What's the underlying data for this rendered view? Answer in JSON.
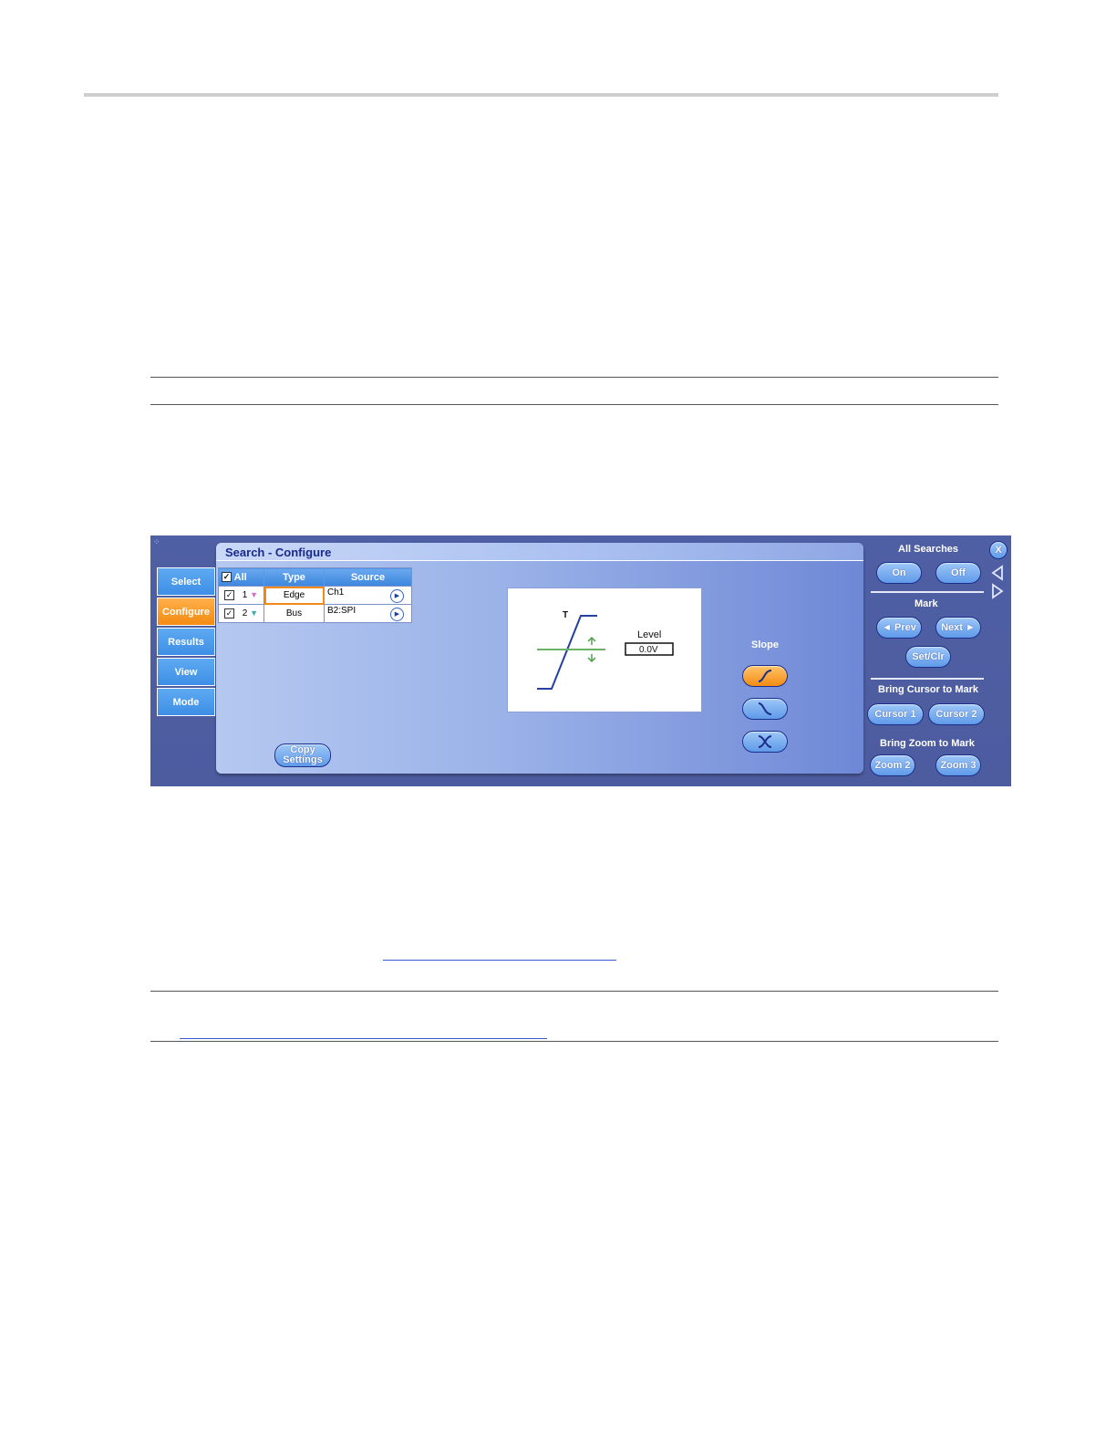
{
  "dialog": {
    "title": "Search - Configure",
    "tabs": [
      {
        "label": "Select",
        "active": false
      },
      {
        "label": "Configure",
        "active": true
      },
      {
        "label": "Results",
        "active": false
      },
      {
        "label": "View",
        "active": false
      },
      {
        "label": "Mode",
        "active": false
      }
    ],
    "table": {
      "headers": {
        "all": "All",
        "type": "Type",
        "source": "Source"
      },
      "rows": [
        {
          "num": "1",
          "type": "Edge",
          "source": "Ch1",
          "marker_color": "#d070c8"
        },
        {
          "num": "2",
          "type": "Bus",
          "source": "B2:SPI",
          "marker_color": "#40a8b8"
        }
      ]
    },
    "diagram": {
      "trigger_mark": "T",
      "level_label": "Level",
      "level_value": "0.0V"
    },
    "slope": {
      "label": "Slope",
      "selected": "rising"
    },
    "copy_settings_label": "Copy Settings"
  },
  "side_panel": {
    "all_searches_label": "All Searches",
    "on_label": "On",
    "off_label": "Off",
    "mark_label": "Mark",
    "prev_label": "◄ Prev",
    "next_label": "Next ►",
    "setclr_label": "Set/Clr",
    "bring_cursor_label": "Bring Cursor to Mark",
    "cursor1_label": "Cursor 1",
    "cursor2_label": "Cursor 2",
    "bring_zoom_label": "Bring Zoom to Mark",
    "zoom2_label": "Zoom 2",
    "zoom3_label": "Zoom 3",
    "close_label": "X"
  }
}
